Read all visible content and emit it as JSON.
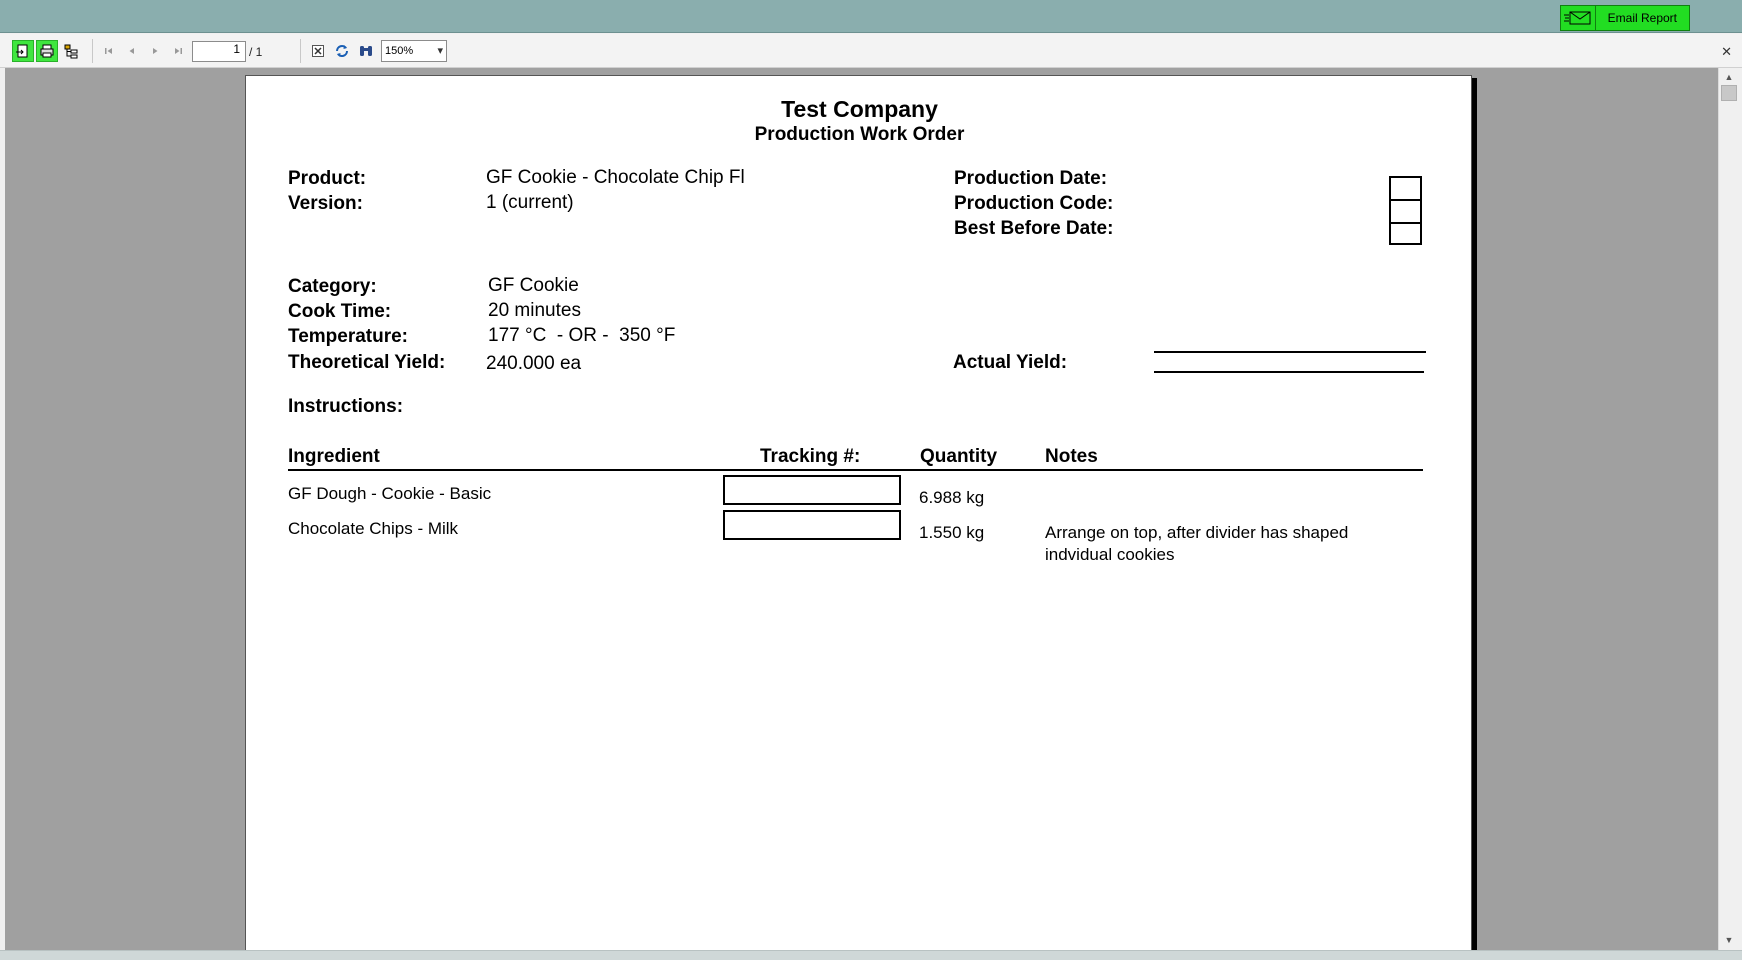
{
  "topbar": {
    "email_label": "Email Report"
  },
  "toolbar": {
    "current_page": "1",
    "page_total": "/ 1",
    "zoom": "150%"
  },
  "report": {
    "company": "Test Company",
    "title": "Production Work Order",
    "product_label": "Product:",
    "product_value": "GF Cookie - Chocolate Chip Fl",
    "version_label": "Version:",
    "version_value": "1 (current)",
    "production_date_label": "Production Date:",
    "production_code_label": "Production Code:",
    "best_before_label": "Best Before Date:",
    "category_label": "Category:",
    "category_value": "GF Cookie",
    "cook_time_label": "Cook Time:",
    "cook_time_value": "20 minutes",
    "temperature_label": "Temperature:",
    "temperature_value": "177 °C  - OR -  350 °F",
    "theoretical_yield_label": "Theoretical Yield:",
    "theoretical_yield_value": "240.000 ea",
    "actual_yield_label": "Actual Yield:",
    "instructions_label": "Instructions:",
    "columns": {
      "ingredient": "Ingredient",
      "tracking": "Tracking #:",
      "quantity": "Quantity",
      "notes": "Notes"
    },
    "ingredients": [
      {
        "name": "GF Dough - Cookie - Basic",
        "quantity": "6.988 kg",
        "notes": "",
        "notes_line2": ""
      },
      {
        "name": "Chocolate Chips - Milk",
        "quantity": "1.550 kg",
        "notes": "Arrange on top, after divider has shaped",
        "notes_line2": "indvidual cookies"
      }
    ]
  },
  "colors": {
    "topbar": "#8aaeae",
    "accent_green": "#22dd22",
    "viewer_bg": "#a0a0a0"
  }
}
